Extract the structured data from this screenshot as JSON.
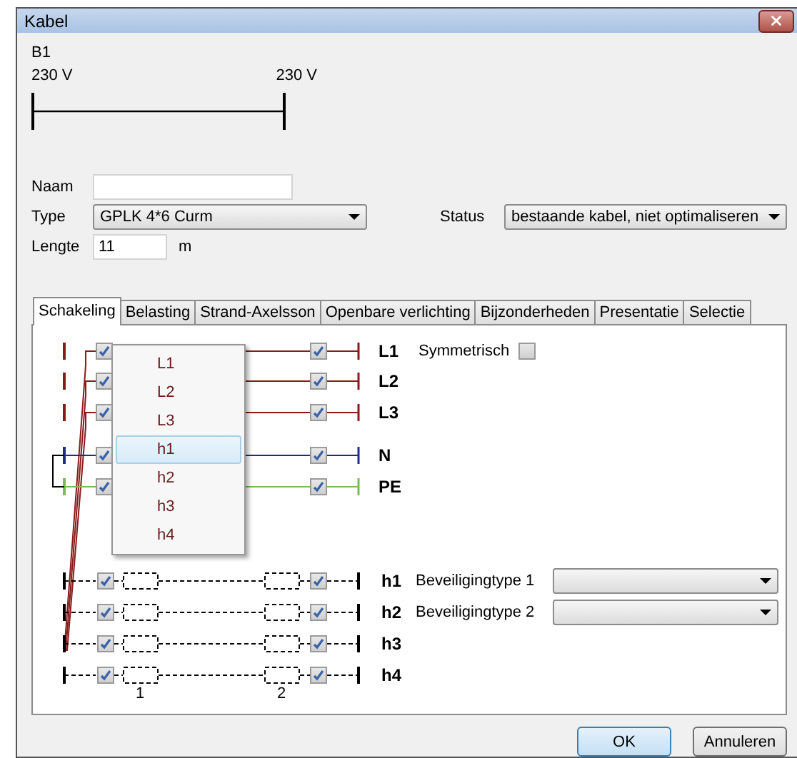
{
  "window": {
    "title": "Kabel"
  },
  "cable_diagram": {
    "node": "B1",
    "voltage_start": "230 V",
    "voltage_end": "230 V"
  },
  "form": {
    "naam": {
      "label": "Naam"
    },
    "type": {
      "label": "Type",
      "value": "GPLK 4*6 Curm"
    },
    "status": {
      "label": "Status",
      "value": "bestaande kabel, niet optimaliseren"
    },
    "lengte": {
      "label": "Lengte",
      "value": "11",
      "unit": "m"
    }
  },
  "tabs": [
    {
      "label": "Schakeling",
      "selected": true
    },
    {
      "label": "Belasting",
      "selected": false
    },
    {
      "label": "Strand-Axelsson",
      "selected": false
    },
    {
      "label": "Openbare verlichting",
      "selected": false
    },
    {
      "label": "Bijzonderheden",
      "selected": false
    },
    {
      "label": "Presentatie",
      "selected": false
    },
    {
      "label": "Selectie",
      "selected": false
    }
  ],
  "conductors": [
    {
      "label": "L1",
      "kind": "phase",
      "color": "#8b1a1a",
      "start_checked": true,
      "end_checked": true
    },
    {
      "label": "L2",
      "kind": "phase",
      "color": "#8b1a1a",
      "start_checked": true,
      "end_checked": true
    },
    {
      "label": "L3",
      "kind": "phase",
      "color": "#8b1a1a",
      "start_checked": true,
      "end_checked": true
    },
    {
      "label": "N",
      "kind": "neutral",
      "color": "#1f2d8a",
      "start_checked": true,
      "end_checked": true
    },
    {
      "label": "PE",
      "kind": "earth",
      "color": "#7cb95a",
      "start_checked": true,
      "end_checked": true
    }
  ],
  "symmetrisch": {
    "label": "Symmetrisch",
    "checked": false
  },
  "aux_circuits": [
    {
      "label": "h1",
      "start_checked": true,
      "end_checked": true
    },
    {
      "label": "h2",
      "start_checked": true,
      "end_checked": true
    },
    {
      "label": "h3",
      "start_checked": true,
      "end_checked": true
    },
    {
      "label": "h4",
      "start_checked": true,
      "end_checked": true
    }
  ],
  "protection_positions": [
    "1",
    "2"
  ],
  "protection_types": [
    {
      "label": "Beveiligingtype 1"
    },
    {
      "label": "Beveiligingtype 2"
    }
  ],
  "dropdown_menu": {
    "items": [
      {
        "label": "L1",
        "selected": false
      },
      {
        "label": "L2",
        "selected": false
      },
      {
        "label": "L3",
        "selected": false
      },
      {
        "label": "h1",
        "selected": true
      },
      {
        "label": "h2",
        "selected": false
      },
      {
        "label": "h3",
        "selected": false
      },
      {
        "label": "h4",
        "selected": false
      }
    ]
  },
  "buttons": [
    {
      "label": "OK",
      "default": true
    },
    {
      "label": "Annuleren",
      "default": false
    }
  ]
}
